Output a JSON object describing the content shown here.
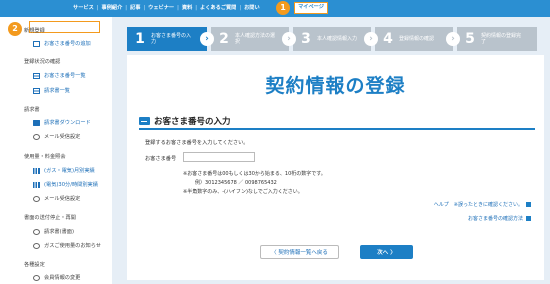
{
  "topnav": {
    "items": [
      "サービス",
      "事例紹介",
      "記事",
      "ウェビナー",
      "資料",
      "よくあるご質問",
      "お問い"
    ],
    "mypage": "マイページ",
    "badge1": "1",
    "badge2": "2"
  },
  "sidebar": {
    "sections": [
      {
        "title": "新規登録",
        "items": [
          {
            "label": "お客さま番号の追加",
            "icon": "add-doc-icon",
            "active": true
          }
        ]
      },
      {
        "title": "登録状況の確認",
        "items": [
          {
            "label": "お客さま番号一覧",
            "icon": "list-icon"
          },
          {
            "label": "請求書一覧",
            "icon": "list-icon"
          }
        ]
      },
      {
        "title": "請求書",
        "items": [
          {
            "label": "請求書ダウンロード",
            "icon": "document-icon"
          },
          {
            "label": "メール受信設定",
            "icon": "gear-icon"
          }
        ]
      },
      {
        "title": "使用量・料金照会",
        "items": [
          {
            "label": "(ガス・電気)月別実績",
            "icon": "bar-chart-icon"
          },
          {
            "label": "(電気)30分/時間別実績",
            "icon": "bar-chart-icon"
          },
          {
            "label": "メール受信設定",
            "icon": "gear-icon"
          }
        ]
      },
      {
        "title": "書面の送付停止・再開",
        "items": [
          {
            "label": "請求書(書面)",
            "icon": "gear-icon"
          },
          {
            "label": "ガスご使用量のお知らせ",
            "icon": "gear-icon"
          }
        ]
      },
      {
        "title": "各種設定",
        "items": [
          {
            "label": "会員情報の変更",
            "icon": "gear-icon"
          }
        ]
      }
    ]
  },
  "steps": [
    {
      "num": "1",
      "label": "お客さま番号の入力"
    },
    {
      "num": "2",
      "label": "本人確認方法の選択"
    },
    {
      "num": "3",
      "label": "本人確認情報入力"
    },
    {
      "num": "4",
      "label": "登録情報の確認"
    },
    {
      "num": "5",
      "label": "契約情報の登録完了"
    }
  ],
  "main": {
    "title": "契約情報の登録",
    "section_title": "お客さま番号の入力",
    "intro": "登録するお客さま番号を入力してください。",
    "field_label": "お客さま番号",
    "field_value": "",
    "notes": [
      "※お客さま番号は00もしくは30から始まる、10桁の数字です。",
      "例）3012345678 ／ 0098765432",
      "※半角数字のみ、-(ハイフン)なしでご入力ください。"
    ],
    "help_link": "ヘルプ　※誤ったときに確認ください。",
    "check_link": "お客さま番号の確認方法",
    "back_button": "〈 契約情報一覧へ戻る",
    "next_button": "次へ 〉"
  },
  "colors": {
    "accent": "#1d7fc5",
    "highlight": "#f39a1e",
    "topbar": "#2b8fd2"
  }
}
